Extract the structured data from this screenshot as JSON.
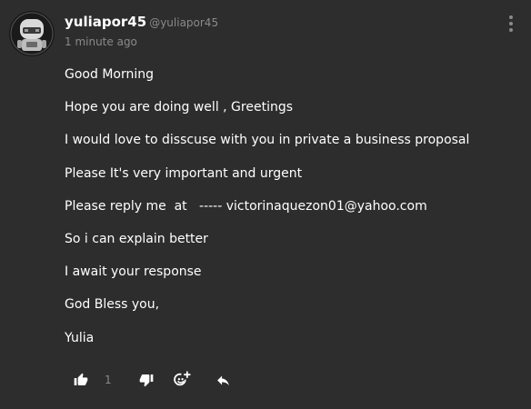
{
  "comment": {
    "username": "yuliapor45",
    "handle": "@yuliapor45",
    "time": "1 minute ago",
    "avatar_icon": "robot-avatar-icon",
    "menu_icon": "kebab-menu-icon",
    "lines": [
      "Good Morning",
      "Hope you are doing well , Greetings",
      "I would love to disscuse with you in private a business proposal",
      "Please It's very important and urgent",
      "Please reply me  at   ----- victorinaquezon01@yahoo.com",
      "So i can explain better",
      "I await your response",
      "God Bless you,",
      "Yulia"
    ],
    "actions": {
      "like_icon": "thumbs-up-icon",
      "like_count": "1",
      "dislike_icon": "thumbs-down-icon",
      "react_icon": "add-reaction-icon",
      "reply_icon": "reply-icon"
    }
  },
  "colors": {
    "background": "#2d2d2d",
    "text": "#ffffff",
    "muted": "#8a8a8a"
  }
}
